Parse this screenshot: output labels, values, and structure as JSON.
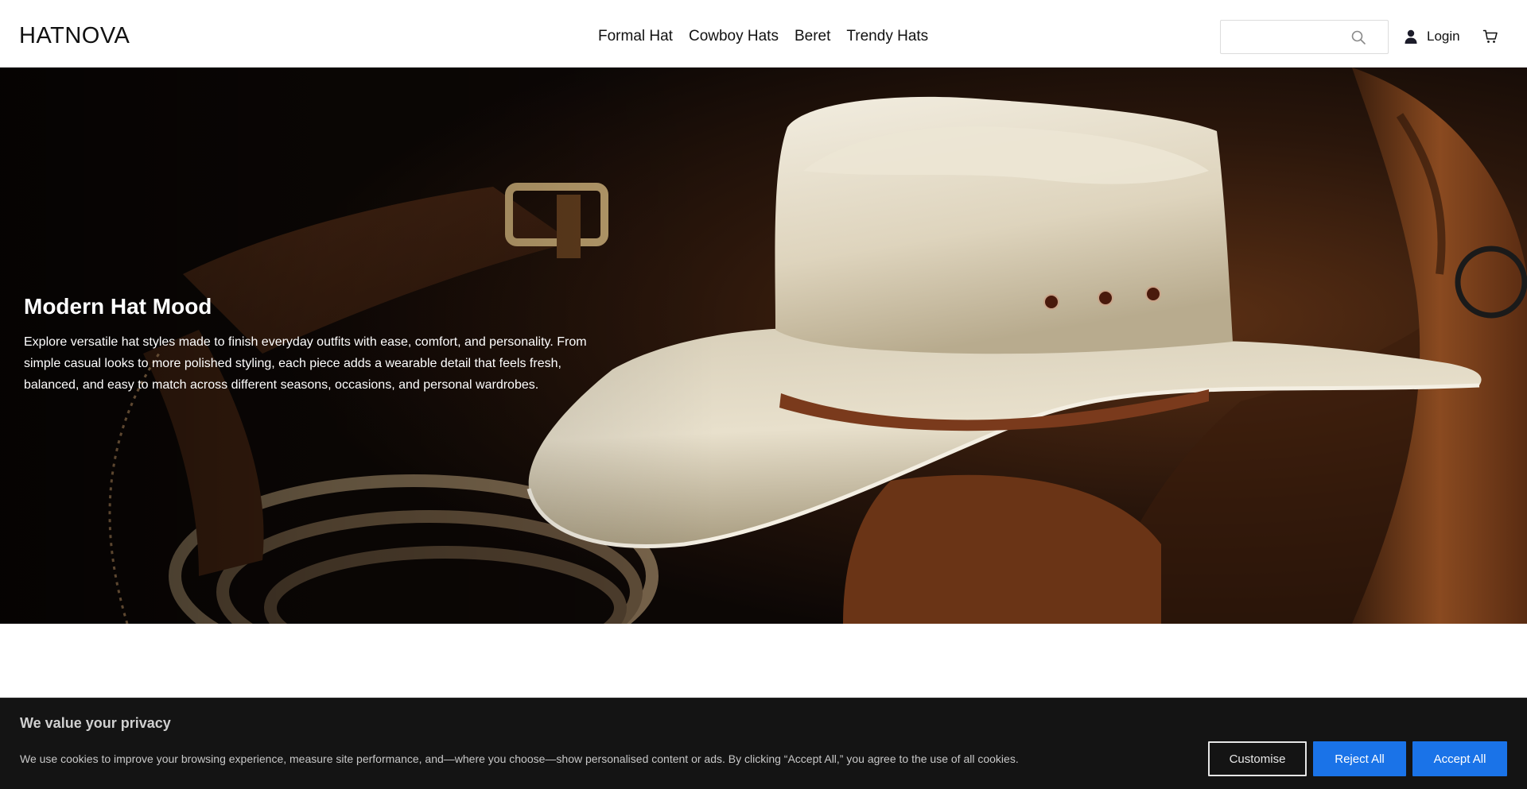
{
  "brand": {
    "logo_text": "HATNOVA"
  },
  "nav": {
    "items": [
      "Formal Hat",
      "Cowboy Hats",
      "Beret",
      "Trendy Hats"
    ]
  },
  "search": {
    "value": "",
    "placeholder": "",
    "icon": "search-icon"
  },
  "account": {
    "login_label": "Login",
    "icon": "user-icon"
  },
  "cart": {
    "icon": "cart-icon"
  },
  "hero": {
    "title": "Modern Hat Mood",
    "description": "Explore versatile hat styles made to finish everyday outfits with ease, comfort, and personality. From simple casual looks to more polished styling, each piece adds a wearable detail that feels fresh, balanced, and easy to match across different seasons, occasions, and personal wardrobes."
  },
  "cookie_banner": {
    "title": "We value your privacy",
    "text": "We use cookies to improve your browsing experience, measure site performance, and—where you choose—show personalised content or ads. By clicking “Accept All,” you agree to the use of all cookies.",
    "customise_label": "Customise",
    "reject_label": "Reject All",
    "accept_label": "Accept All"
  },
  "colors": {
    "accent_button": "#1a73e8",
    "banner_background": "#141414",
    "header_background": "#ffffff",
    "hat_cream": "#e9e1cf",
    "leather_brown": "#6b3a1d"
  }
}
